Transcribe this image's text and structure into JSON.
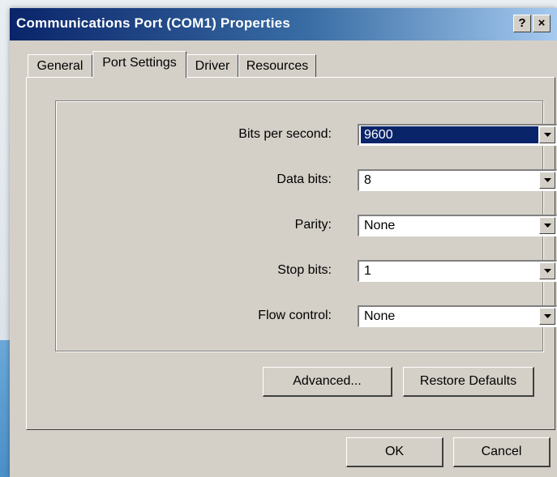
{
  "window": {
    "title": "Communications Port (COM1) Properties",
    "help_label": "?",
    "close_label": "×"
  },
  "tabs": [
    {
      "label": "General",
      "active": false
    },
    {
      "label": "Port Settings",
      "active": true
    },
    {
      "label": "Driver",
      "active": false
    },
    {
      "label": "Resources",
      "active": false
    }
  ],
  "settings": {
    "bits_per_second": {
      "label": "Bits per second:",
      "value": "9600"
    },
    "data_bits": {
      "label": "Data bits:",
      "value": "8"
    },
    "parity": {
      "label": "Parity:",
      "value": "None"
    },
    "stop_bits": {
      "label": "Stop bits:",
      "value": "1"
    },
    "flow_control": {
      "label": "Flow control:",
      "value": "None"
    }
  },
  "buttons": {
    "advanced": "Advanced...",
    "restore_defaults": "Restore Defaults",
    "ok": "OK",
    "cancel": "Cancel"
  },
  "colors": {
    "titlebar_start": "#0a246a",
    "titlebar_end": "#a6caf0",
    "selection": "#0a246a",
    "dialog_face": "#d4d0c8"
  }
}
